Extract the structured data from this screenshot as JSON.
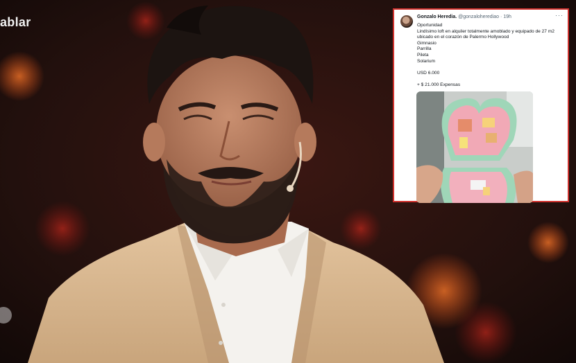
{
  "broadcast": {
    "caption_fragment": "ablar"
  },
  "tweet": {
    "author_name": "Gonzalo Heredia.",
    "author_handle": "@gonzaloherediao",
    "separator": "·",
    "time": "19h",
    "more_icon": "more-dots-icon",
    "lines": [
      "Oportunidad",
      "Lindísimo loft en alquiler totalmente amoblado y equipado de 27 m2",
      "ubicado en el corazón de Palermo Hollywood",
      "Gimnasio",
      "Parrilla",
      "Pileta",
      "Solarium",
      "",
      "USD 6.000",
      "",
      "+ $ 21.000 Expensas"
    ],
    "photo_subject": "polly-pocket-toy"
  },
  "colors": {
    "tweet_border": "#d0312d",
    "background_warm": "#3a1410",
    "jacket": "#d8b892"
  }
}
